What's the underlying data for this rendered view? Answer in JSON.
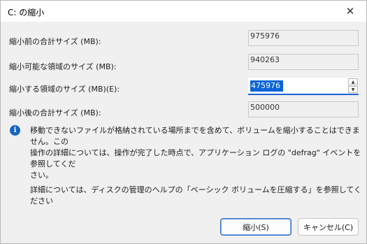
{
  "window": {
    "title": "C: の縮小",
    "close_glyph": "✕"
  },
  "fields": {
    "total_before": {
      "label": "縮小前の合計サイズ (MB):",
      "value": "975976"
    },
    "available": {
      "label": "縮小可能な領域のサイズ (MB):",
      "value": "940263"
    },
    "shrink_amount": {
      "label": "縮小する領域のサイズ (MB)(E):",
      "value": "475976"
    },
    "total_after": {
      "label": "縮小後の合計サイズ (MB):",
      "value": "500000"
    }
  },
  "info": {
    "icon": "info-icon",
    "line1": "移動できないファイルが格納されている場所までを含めて、ボリュームを縮小することはできません。この",
    "line2": "操作の詳細については、操作が完了した時点で、アプリケーション ログの \"defrag\" イベントを参照してくだ",
    "line3": "さい。"
  },
  "help": "詳細については、ディスクの管理のヘルプの「ベーシック ボリュームを圧縮する」を参照してください",
  "buttons": {
    "shrink": "縮小(S)",
    "cancel": "キャンセル(C)"
  },
  "colors": {
    "accent": "#0a64d8",
    "info_icon": "#1565c0",
    "dialog_bg": "#f0f0f0"
  }
}
